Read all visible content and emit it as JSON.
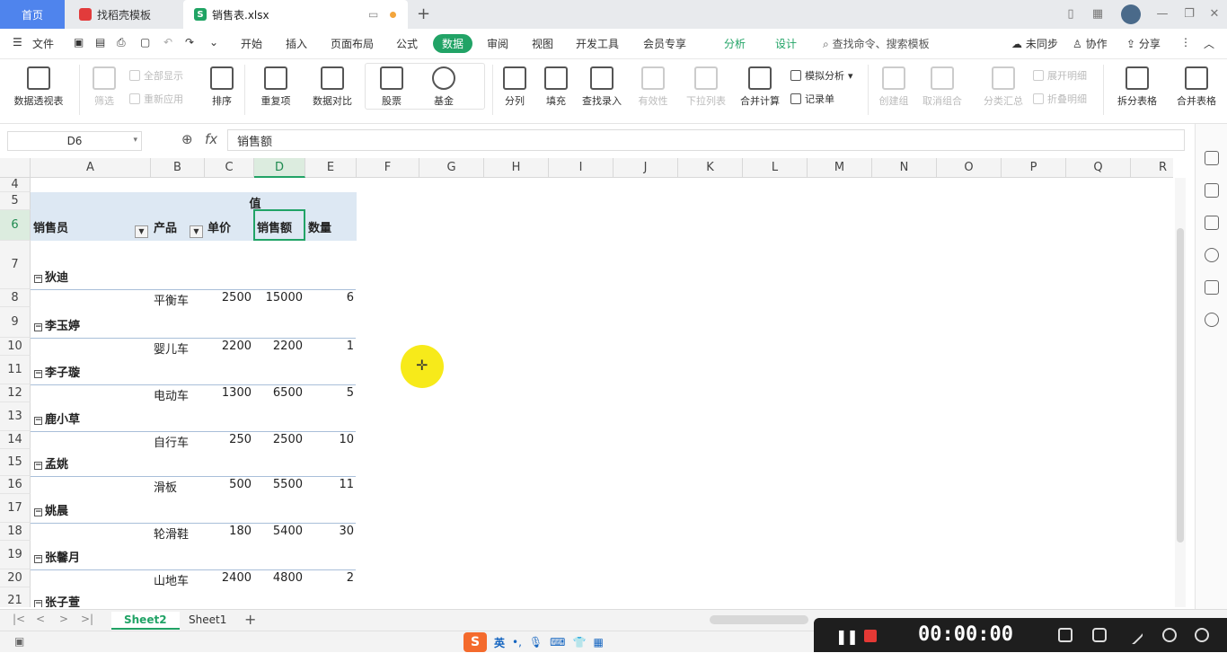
{
  "tabs": {
    "home": "首页",
    "template": "找稻壳模板",
    "file": "销售表.xlsx",
    "add": "+"
  },
  "menu": {
    "file": "文件",
    "items": [
      "开始",
      "插入",
      "页面布局",
      "公式",
      "数据",
      "审阅",
      "视图",
      "开发工具",
      "会员专享",
      "分析",
      "设计"
    ],
    "search": "查找命令、搜索模板",
    "sync": "未同步",
    "collab": "协作",
    "share": "分享"
  },
  "ribbon": {
    "pivot": "数据透视表",
    "filter": "筛选",
    "show_all": "全部显示",
    "reapply": "重新应用",
    "sort": "排序",
    "duplicates": "重复项",
    "compare": "数据对比",
    "stock": "股票",
    "fund": "基金",
    "split": "分列",
    "fill": "填充",
    "lookup": "查找录入",
    "validity": "有效性",
    "dropdown": "下拉列表",
    "consolidate": "合并计算",
    "simulate": "模拟分析",
    "record": "记录单",
    "group": "创建组",
    "ungroup": "取消组合",
    "subtotal": "分类汇总",
    "expand": "展开明细",
    "collapse": "折叠明细",
    "split_table": "拆分表格",
    "merge_table": "合并表格"
  },
  "formula": {
    "cell_ref": "D6",
    "fx": "fx",
    "value": "销售额"
  },
  "columns": [
    "A",
    "B",
    "C",
    "D",
    "E",
    "F",
    "G",
    "H",
    "I",
    "J",
    "K",
    "L",
    "M",
    "N",
    "O",
    "P",
    "Q",
    "R"
  ],
  "rows": [
    "4",
    "5",
    "6",
    "7",
    "8",
    "9",
    "10",
    "11",
    "12",
    "13",
    "14",
    "15",
    "16",
    "17",
    "18",
    "19",
    "20",
    "21"
  ],
  "pivot": {
    "values_label": "值",
    "headers": [
      "销售员",
      "产品",
      "单价",
      "销售额",
      "数量"
    ],
    "groups": [
      {
        "name": "狄迪",
        "product": "平衡车",
        "price": "2500",
        "sales": "15000",
        "qty": "6"
      },
      {
        "name": "李玉婷",
        "product": "婴儿车",
        "price": "2200",
        "sales": "2200",
        "qty": "1"
      },
      {
        "name": "李子璇",
        "product": "电动车",
        "price": "1300",
        "sales": "6500",
        "qty": "5"
      },
      {
        "name": "鹿小草",
        "product": "自行车",
        "price": "250",
        "sales": "2500",
        "qty": "10"
      },
      {
        "name": "孟姚",
        "product": "滑板",
        "price": "500",
        "sales": "5500",
        "qty": "11"
      },
      {
        "name": "姚晨",
        "product": "轮滑鞋",
        "price": "180",
        "sales": "5400",
        "qty": "30"
      },
      {
        "name": "张馨月",
        "product": "山地车",
        "price": "2400",
        "sales": "4800",
        "qty": "2"
      },
      {
        "name": "张子萱"
      }
    ]
  },
  "sheets": [
    "Sheet2",
    "Sheet1"
  ],
  "ime": {
    "lang": "英",
    "logo": "S"
  },
  "recorder": {
    "time": "00:00:00"
  }
}
